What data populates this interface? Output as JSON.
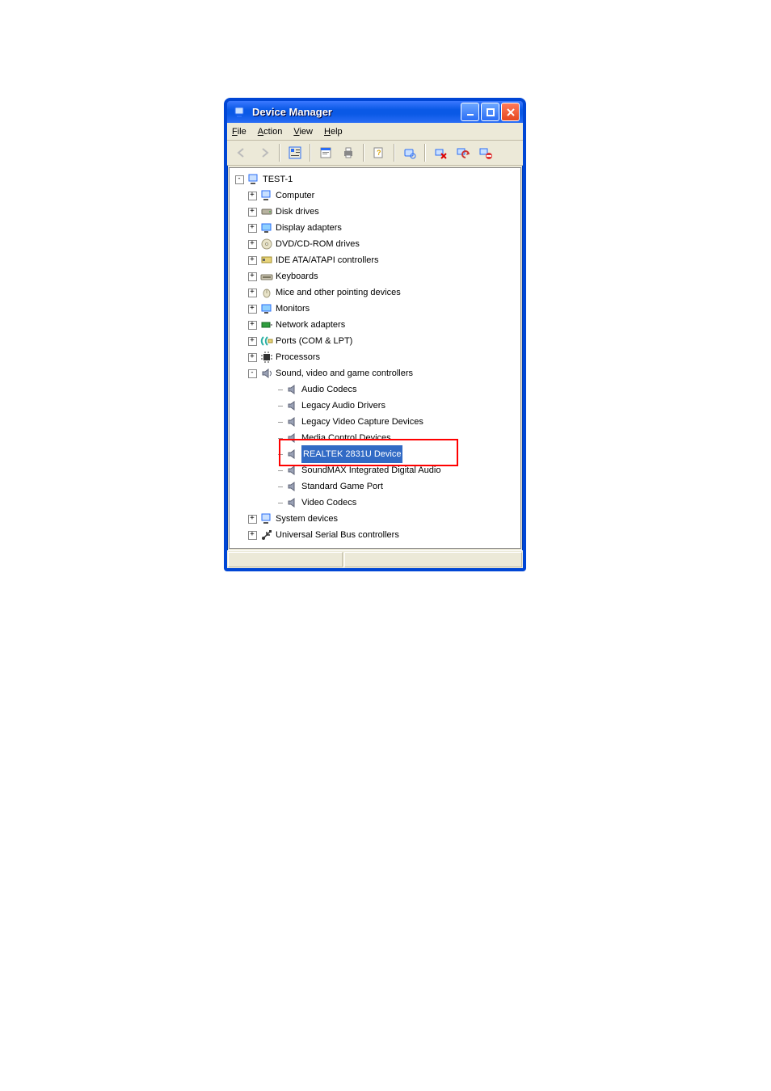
{
  "window": {
    "title": "Device Manager",
    "buttons": {
      "minimize": "–",
      "maximize": "□",
      "close": "×"
    }
  },
  "menu": {
    "file": "File",
    "action": "Action",
    "view": "View",
    "help": "Help"
  },
  "toolbar_icons": [
    "back-icon",
    "forward-icon",
    "tree-view-icon",
    "properties-icon",
    "print-icon",
    "help-icon",
    "scan-hardware-icon",
    "uninstall-icon",
    "update-driver-icon",
    "disable-icon"
  ],
  "tree": {
    "root": "TEST-1",
    "categories": [
      {
        "name": "Computer"
      },
      {
        "name": "Disk drives"
      },
      {
        "name": "Display adapters"
      },
      {
        "name": "DVD/CD-ROM drives"
      },
      {
        "name": "IDE ATA/ATAPI controllers"
      },
      {
        "name": "Keyboards"
      },
      {
        "name": "Mice and other pointing devices"
      },
      {
        "name": "Monitors"
      },
      {
        "name": "Network adapters"
      },
      {
        "name": "Ports (COM & LPT)"
      },
      {
        "name": "Processors"
      },
      {
        "name": "Sound, video and game controllers",
        "expanded": true,
        "children": [
          "Audio Codecs",
          "Legacy Audio Drivers",
          "Legacy Video Capture Devices",
          "Media Control Devices",
          "REALTEK 2831U Device",
          "SoundMAX Integrated Digital Audio",
          "Standard Game Port",
          "Video Codecs"
        ],
        "selected_child_index": 4,
        "red_highlight_child_indices": [
          3,
          4
        ]
      },
      {
        "name": "System devices"
      },
      {
        "name": "Universal Serial Bus controllers"
      }
    ]
  }
}
